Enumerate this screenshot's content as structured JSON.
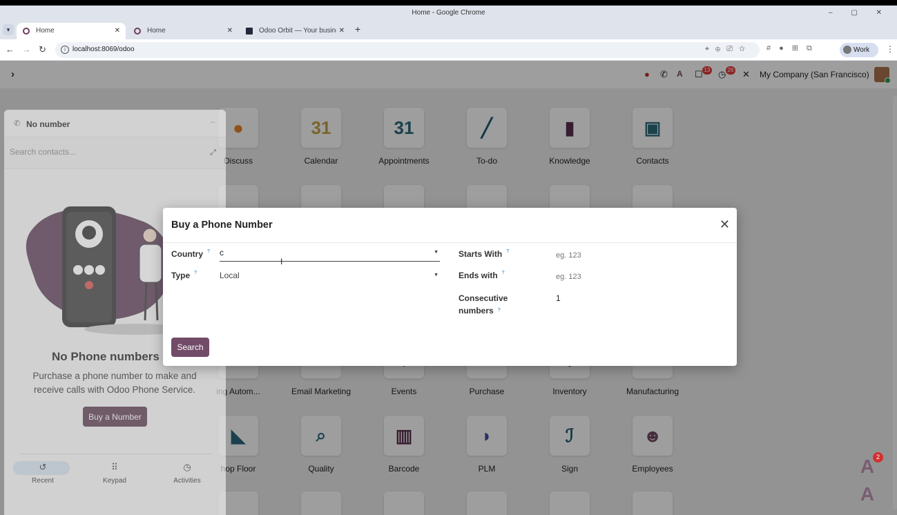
{
  "window": {
    "title": "Home - Google Chrome"
  },
  "tabs": [
    {
      "label": "Home",
      "active": true
    },
    {
      "label": "Home",
      "active": false
    },
    {
      "label": "Odoo Orbit — Your business",
      "active": false
    }
  ],
  "toolbar": {
    "url": "localhost:8069/odoo",
    "profile_label": "Work"
  },
  "navbar": {
    "company": "My Company (San Francisco)",
    "messages_badge": "13",
    "activities_badge": "26"
  },
  "apps": [
    {
      "name": "Discuss",
      "glyph": "●",
      "color": "#e8832a"
    },
    {
      "name": "Calendar",
      "glyph": "31",
      "color": "#c7a34a"
    },
    {
      "name": "Appointments",
      "glyph": "31",
      "color": "#2b6a7c"
    },
    {
      "name": "To-do",
      "glyph": "╱",
      "color": "#1f5a6e"
    },
    {
      "name": "Knowledge",
      "glyph": "▮",
      "color": "#5a2f4f"
    },
    {
      "name": "Contacts",
      "glyph": "▣",
      "color": "#2d6a7a"
    },
    {
      "name": "ing Autom...",
      "glyph": "⚙",
      "color": "#714b67"
    },
    {
      "name": "Email Marketing",
      "glyph": "✉",
      "color": "#714b67"
    },
    {
      "name": "Events",
      "glyph": "◆",
      "color": "#e8832a"
    },
    {
      "name": "Purchase",
      "glyph": "▬",
      "color": "#714b67"
    },
    {
      "name": "Inventory",
      "glyph": "◆",
      "color": "#714b67"
    },
    {
      "name": "Manufacturing",
      "glyph": "⚙",
      "color": "#2d6a7a"
    },
    {
      "name": "hop Floor",
      "glyph": "◣",
      "color": "#2b6a7c"
    },
    {
      "name": "Quality",
      "glyph": "⌕",
      "color": "#2b6a7c"
    },
    {
      "name": "Barcode",
      "glyph": "▥",
      "color": "#5a2f4f"
    },
    {
      "name": "PLM",
      "glyph": "◗",
      "color": "#4b4ca0"
    },
    {
      "name": "Sign",
      "glyph": "ℐ",
      "color": "#1f5a6e"
    },
    {
      "name": "Employees",
      "glyph": "☻",
      "color": "#714b67"
    }
  ],
  "softphone": {
    "title": "No number",
    "search_placeholder": "Search contacts...",
    "empty_title": "No Phone numbers y",
    "empty_text": "Purchase a phone number to make and receive calls with Odoo Phone Service.",
    "buy_button": "Buy a Number",
    "tabs": [
      {
        "label": "Recent",
        "icon": "history-icon"
      },
      {
        "label": "Keypad",
        "icon": "keypad-icon"
      },
      {
        "label": "Activities",
        "icon": "clock-icon"
      }
    ]
  },
  "dialog": {
    "title": "Buy a Phone Number",
    "country_label": "Country",
    "country_value": "c",
    "type_label": "Type",
    "type_value": "Local",
    "starts_with_label": "Starts With",
    "starts_with_placeholder": "eg. 123",
    "ends_with_label": "Ends with",
    "ends_with_placeholder": "eg. 123",
    "consecutive_label_1": "Consecutive",
    "consecutive_label_2": "numbers",
    "consecutive_value": "1",
    "search_button": "Search"
  },
  "ai_badge": "2",
  "colors": {
    "brand": "#714b67",
    "badge": "#e03d3d"
  }
}
